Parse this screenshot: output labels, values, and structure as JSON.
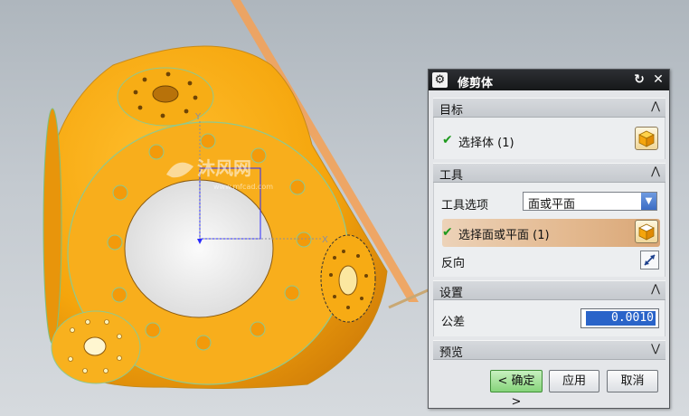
{
  "watermark": {
    "name": "沐风网",
    "url": "www.mfcad.com"
  },
  "viewport": {
    "axis_x": "X",
    "axis_y": "Y",
    "colors": {
      "part_fill": "#f5a50c",
      "part_dark": "#d8880a",
      "plane": "#f2a25a",
      "background": "#c4cad0"
    }
  },
  "dialog": {
    "title": "修剪体",
    "title_icon": "gear-icon",
    "reset_icon": "reset-icon",
    "close_icon": "close-icon",
    "sections": {
      "target": {
        "label": "目标",
        "select_body": "选择体 (1)"
      },
      "tool": {
        "label": "工具",
        "tool_option_label": "工具选项",
        "tool_option_value": "面或平面",
        "select_face": "选择面或平面 (1)",
        "reverse_label": "反向"
      },
      "settings": {
        "label": "设置",
        "tolerance_label": "公差",
        "tolerance_value": "0.0010"
      },
      "preview": {
        "label": "预览"
      }
    },
    "buttons": {
      "ok": "< 确定 >",
      "apply": "应用",
      "cancel": "取消"
    }
  }
}
